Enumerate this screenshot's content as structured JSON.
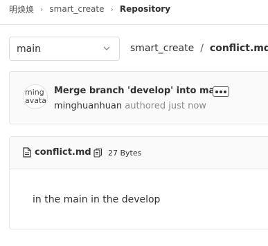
{
  "breadcrumb": {
    "items": [
      "明焕焕",
      "smart_create"
    ],
    "current": "Repository"
  },
  "branch": {
    "selected": "main"
  },
  "path": {
    "dir": "smart_create",
    "separator": "/",
    "file": "conflict.md"
  },
  "commit": {
    "avatar_lines": [
      "ming",
      "avata"
    ],
    "title": "Merge branch 'develop' into main",
    "author": "minghuanhuan",
    "action": "authored",
    "time": "just now"
  },
  "file": {
    "name": "conflict.md",
    "size": "27 Bytes",
    "content": "in the main in the develop"
  },
  "icons": {
    "chevron": "chevron-down-icon",
    "file": "file-icon",
    "copy": "copy-icon",
    "ellipsis": "ellipsis-icon"
  }
}
